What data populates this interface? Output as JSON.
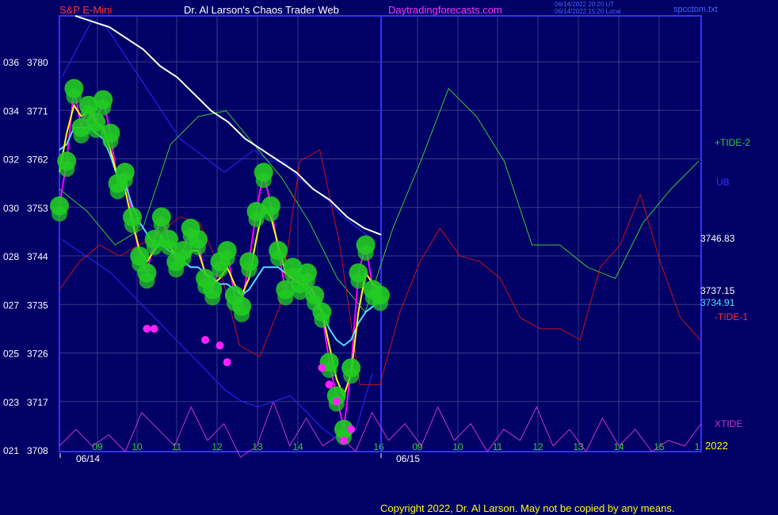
{
  "header": {
    "symbol": "S&P E-Mini",
    "title": "Dr. Al Larson's Chaos Trader Web",
    "site": "Daytradingforecasts.com",
    "stamp_line1": "06/14/2022 20:20 UT",
    "stamp_line2": "06/14/2022 15:20 Local",
    "file": "spcctom.txt"
  },
  "footer": {
    "copyright": "Copyright 2022, Dr. Al Larson. May not be copied by any means."
  },
  "colors": {
    "background": "#000066",
    "grid": "#3a3a8a",
    "frame": "#3333ff",
    "price_white": "#ffffff",
    "ma_yellow": "#ffff00",
    "ma_cyan": "#55ddff",
    "band_blue": "#2222ee",
    "tide2_green": "#33cc33",
    "tide1_red": "#cc1111",
    "xtide_magenta": "#cc33cc",
    "dot_green": "#22cc22",
    "dot_magenta": "#ff22ff"
  },
  "chart_data": {
    "type": "line",
    "ylim": [
      3708,
      3786
    ],
    "y_ticks": [
      {
        "left": "036",
        "right": "3780"
      },
      {
        "left": "034",
        "right": "3771"
      },
      {
        "left": "032",
        "right": "3762"
      },
      {
        "left": "030",
        "right": "3753"
      },
      {
        "left": "028",
        "right": "3744"
      },
      {
        "left": "027",
        "right": "3735"
      },
      {
        "left": "025",
        "right": "3726"
      },
      {
        "left": "023",
        "right": "3717"
      },
      {
        "left": "021",
        "right": "3708"
      }
    ],
    "x_hours_day1": [
      "09",
      "10",
      "11",
      "12",
      "13",
      "14",
      "16"
    ],
    "x_hours_day2": [
      "09",
      "10",
      "11",
      "12",
      "13",
      "14",
      "15",
      "1"
    ],
    "dates": [
      "06/14",
      "06/15"
    ],
    "year_label": "2022",
    "right_labels": [
      {
        "text": "+TIDE-2",
        "color": "#33cc33"
      },
      {
        "text": "UB",
        "color": "#3333ff"
      },
      {
        "text": "3746.83",
        "color": "#ffffff"
      },
      {
        "text": "3737.15",
        "color": "#ffffff"
      },
      {
        "text": "3734.91",
        "color": "#55ddff"
      },
      {
        "text": "-TIDE-1",
        "color": "#ff3333"
      },
      {
        "text": "XTIDE",
        "color": "#cc33cc"
      }
    ],
    "series": [
      {
        "key": "price",
        "values": [
          3752,
          3760,
          3773,
          3766,
          3770,
          3767,
          3771,
          3765,
          3756,
          3758,
          3750,
          3743,
          3740,
          3746,
          3750,
          3746,
          3742,
          3744,
          3748,
          3746,
          3739,
          3737,
          3742,
          3744,
          3736,
          3734,
          3742,
          3751,
          3758,
          3752,
          3744,
          3737,
          3741,
          3738,
          3740,
          3736,
          3733,
          3724,
          3718,
          3712,
          3723,
          3740,
          3745,
          3737,
          3736
        ]
      },
      {
        "key": "yellow_ma",
        "values": [
          3758,
          3765,
          3770,
          3768,
          3769,
          3767,
          3766,
          3762,
          3757,
          3755,
          3749,
          3744,
          3742,
          3744,
          3746,
          3745,
          3743,
          3742,
          3744,
          3744,
          3740,
          3738,
          3739,
          3741,
          3738,
          3736,
          3739,
          3746,
          3752,
          3750,
          3745,
          3740,
          3739,
          3738,
          3738,
          3736,
          3733,
          3727,
          3721,
          3718,
          3722,
          3733,
          3740,
          3738,
          3737.15
        ]
      },
      {
        "key": "cyan_ma",
        "values": [
          3762,
          3763,
          3766,
          3766,
          3766,
          3765,
          3764,
          3761,
          3757,
          3756,
          3752,
          3749,
          3747,
          3745,
          3745,
          3744,
          3743,
          3742,
          3741,
          3741,
          3740,
          3739,
          3738,
          3738,
          3737,
          3736,
          3737,
          3739,
          3741,
          3741,
          3741,
          3740,
          3739,
          3738,
          3737,
          3735,
          3733,
          3730,
          3728,
          3727,
          3728,
          3731,
          3733,
          3734,
          3734.91
        ]
      },
      {
        "key": "white_ma",
        "values": [
          3786,
          3785,
          3784,
          3782,
          3780,
          3777,
          3775,
          3772,
          3769,
          3767,
          3764,
          3762,
          3760,
          3758,
          3755,
          3753,
          3750,
          3748,
          3746.83
        ]
      },
      {
        "key": "upper_band",
        "values": [
          3775,
          3780,
          3785,
          3784,
          3780,
          3776,
          3772,
          3768,
          3764,
          3762,
          3760,
          3758,
          3760,
          3762,
          3760,
          3760,
          3757,
          3755,
          3753,
          3750,
          3748,
          3746
        ]
      },
      {
        "key": "lower_band",
        "values": [
          3746,
          3744,
          3742,
          3740,
          3737,
          3734,
          3731,
          3728,
          3725,
          3722,
          3719,
          3717,
          3716,
          3717,
          3718,
          3715,
          3712,
          3710,
          3712,
          3722
        ]
      },
      {
        "key": "tide_plus2",
        "values": [
          3755,
          3751,
          3745,
          3748,
          3763,
          3768,
          3769,
          3763,
          3757,
          3749,
          3739,
          3733,
          3748,
          3760,
          3773,
          3768,
          3760,
          3745,
          3745,
          3741,
          3739,
          3749,
          3755,
          3760
        ]
      },
      {
        "key": "tide_minus1",
        "values": [
          3737,
          3742,
          3745,
          3743,
          3745,
          3747,
          3750,
          3749,
          3741,
          3727,
          3725,
          3734,
          3760,
          3762,
          3745,
          3720,
          3720,
          3733,
          3742,
          3748,
          3743,
          3742,
          3739,
          3732,
          3730,
          3730,
          3728,
          3741,
          3745,
          3754,
          3742,
          3732,
          3728
        ]
      },
      {
        "key": "xtide",
        "values": [
          3709,
          3712,
          3709,
          3711,
          3708,
          3715,
          3712,
          3709,
          3716,
          3710,
          3713,
          3707,
          3709,
          3717,
          3709,
          3714,
          3709,
          3711,
          3708,
          3715,
          3710,
          3713,
          3709,
          3716,
          3710,
          3713,
          3708,
          3712,
          3710,
          3716,
          3709,
          3712,
          3708,
          3714,
          3709,
          3712,
          3708,
          3710,
          3709,
          3713
        ]
      }
    ]
  }
}
